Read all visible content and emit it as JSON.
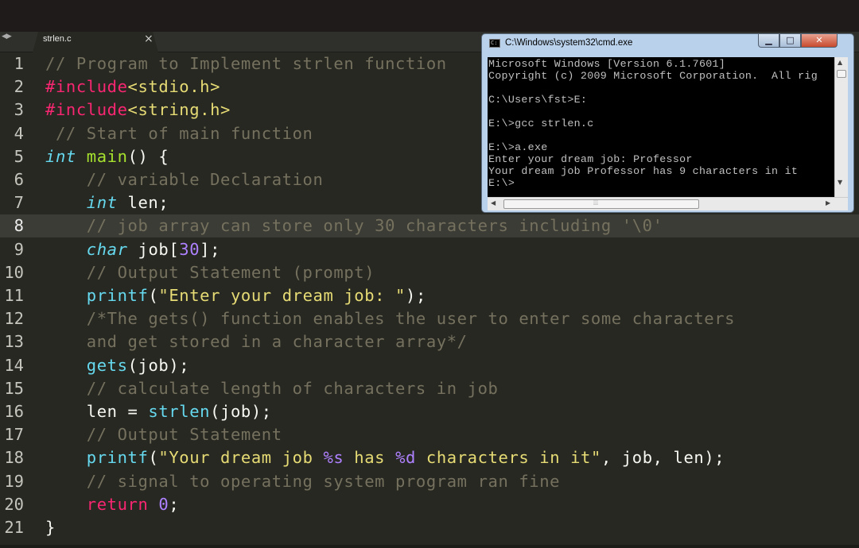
{
  "tab": {
    "label": "strlen.c",
    "close_glyph": "×",
    "nav_glyph": "◀▶"
  },
  "editor": {
    "theme_colors": {
      "background": "#272822",
      "comment": "#75715e",
      "keyword": "#f92672",
      "function": "#a6e22e",
      "type": "#66d9ef",
      "string": "#e6db74",
      "number": "#ae81ff"
    },
    "highlighted_line": "8",
    "lines": [
      {
        "n": "1",
        "tokens": [
          {
            "t": "comment",
            "v": "// Program to Implement strlen function"
          }
        ]
      },
      {
        "n": "2",
        "tokens": [
          {
            "t": "directive",
            "v": "#include"
          },
          {
            "t": "string",
            "v": "<stdio.h>"
          }
        ]
      },
      {
        "n": "3",
        "tokens": [
          {
            "t": "directive",
            "v": "#include"
          },
          {
            "t": "string",
            "v": "<string.h>"
          }
        ]
      },
      {
        "n": "4",
        "tokens": [
          {
            "t": "comment",
            "v": " // Start of main function"
          }
        ]
      },
      {
        "n": "5",
        "tokens": [
          {
            "t": "keyword-ital",
            "v": "int"
          },
          {
            "t": "plain",
            "v": " "
          },
          {
            "t": "func",
            "v": "main"
          },
          {
            "t": "plain",
            "v": "() {"
          }
        ]
      },
      {
        "n": "6",
        "tokens": [
          {
            "t": "comment",
            "v": "    // variable Declaration"
          }
        ]
      },
      {
        "n": "7",
        "tokens": [
          {
            "t": "plain",
            "v": "    "
          },
          {
            "t": "keyword-ital",
            "v": "int"
          },
          {
            "t": "plain",
            "v": " len;"
          }
        ]
      },
      {
        "n": "8",
        "tokens": [
          {
            "t": "comment",
            "v": "    // job array can store only 30 characters including '\\0'"
          }
        ]
      },
      {
        "n": "9",
        "tokens": [
          {
            "t": "plain",
            "v": "    "
          },
          {
            "t": "keyword-ital",
            "v": "char"
          },
          {
            "t": "plain",
            "v": " job["
          },
          {
            "t": "number",
            "v": "30"
          },
          {
            "t": "plain",
            "v": "];"
          }
        ]
      },
      {
        "n": "10",
        "tokens": [
          {
            "t": "comment",
            "v": "    // Output Statement (prompt)"
          }
        ]
      },
      {
        "n": "11",
        "tokens": [
          {
            "t": "plain",
            "v": "    "
          },
          {
            "t": "support",
            "v": "printf"
          },
          {
            "t": "plain",
            "v": "("
          },
          {
            "t": "string",
            "v": "\"Enter your dream job: \""
          },
          {
            "t": "plain",
            "v": ");"
          }
        ]
      },
      {
        "n": "12",
        "tokens": [
          {
            "t": "comment",
            "v": "    /*The gets() function enables the user to enter some characters"
          }
        ]
      },
      {
        "n": "13",
        "tokens": [
          {
            "t": "comment",
            "v": "    and get stored in a character array*/"
          }
        ]
      },
      {
        "n": "14",
        "tokens": [
          {
            "t": "plain",
            "v": "    "
          },
          {
            "t": "support",
            "v": "gets"
          },
          {
            "t": "plain",
            "v": "(job);"
          }
        ]
      },
      {
        "n": "15",
        "tokens": [
          {
            "t": "comment",
            "v": "    // calculate length of characters in job"
          }
        ]
      },
      {
        "n": "16",
        "tokens": [
          {
            "t": "plain",
            "v": "    len = "
          },
          {
            "t": "support",
            "v": "strlen"
          },
          {
            "t": "plain",
            "v": "(job);"
          }
        ]
      },
      {
        "n": "17",
        "tokens": [
          {
            "t": "comment",
            "v": "    // Output Statement"
          }
        ]
      },
      {
        "n": "18",
        "tokens": [
          {
            "t": "plain",
            "v": "    "
          },
          {
            "t": "support",
            "v": "printf"
          },
          {
            "t": "plain",
            "v": "("
          },
          {
            "t": "string",
            "v": "\"Your dream job "
          },
          {
            "t": "format",
            "v": "%s"
          },
          {
            "t": "string",
            "v": " has "
          },
          {
            "t": "format",
            "v": "%d"
          },
          {
            "t": "string",
            "v": " characters in it\""
          },
          {
            "t": "plain",
            "v": ", job, len);"
          }
        ]
      },
      {
        "n": "19",
        "tokens": [
          {
            "t": "comment",
            "v": "    // signal to operating system program ran fine"
          }
        ]
      },
      {
        "n": "20",
        "tokens": [
          {
            "t": "plain",
            "v": "    "
          },
          {
            "t": "keyword",
            "v": "return"
          },
          {
            "t": "plain",
            "v": " "
          },
          {
            "t": "number",
            "v": "0"
          },
          {
            "t": "plain",
            "v": ";"
          }
        ]
      },
      {
        "n": "21",
        "tokens": [
          {
            "t": "plain",
            "v": "}"
          }
        ]
      }
    ]
  },
  "cmd": {
    "title": "C:\\Windows\\system32\\cmd.exe",
    "icon": "cmd-icon",
    "buttons": {
      "minimize": "▁",
      "maximize": "□",
      "close": "✕"
    },
    "output": "Microsoft Windows [Version 6.1.7601]\nCopyright (c) 2009 Microsoft Corporation.  All rig\n\nC:\\Users\\fst>E:\n\nE:\\>gcc strlen.c\n\nE:\\>a.exe\nEnter your dream job: Professor\nYour dream job Professor has 9 characters in it\nE:\\>",
    "scroll": {
      "up": "▲",
      "down": "▼",
      "left": "◀",
      "right": "▶",
      "grip": "⦙⦙⦙"
    }
  }
}
